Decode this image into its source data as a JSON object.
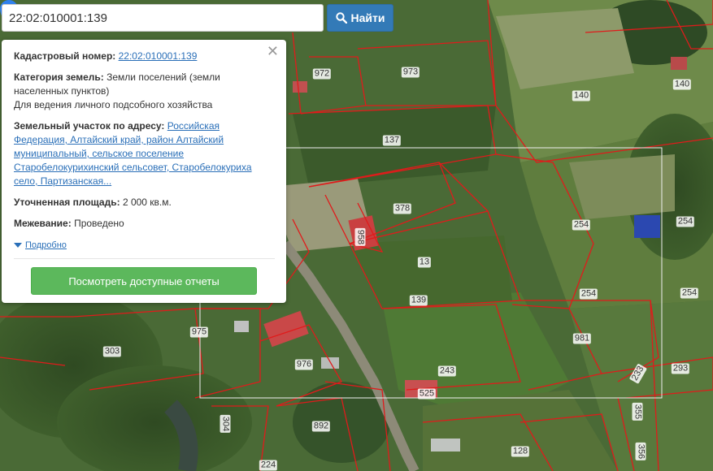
{
  "search": {
    "value": "22:02:010001:139",
    "button_label": "Найти"
  },
  "popup": {
    "cadastral_label": "Кадастровый номер:",
    "cadastral_value": "22:02:010001:139",
    "category_label": "Категория земель:",
    "category_value": "Земли поселений (земли населенных пунктов)",
    "category_note": "Для ведения личного подсобного хозяйства",
    "address_label": "Земельный участок по адресу:",
    "address_value": "Российская Федерация, Алтайский край, район Алтайский муниципальный, сельское поселение Старобелокурихинский сельсовет, Старобелокуриха село, Партизанская...",
    "area_label": "Уточненная площадь:",
    "area_value": "2 000 кв.м.",
    "survey_label": "Межевание:",
    "survey_value": "Проведено",
    "details_label": "Подробно",
    "reports_button": "Посмотреть доступные отчеты"
  },
  "map": {
    "parcels": [
      "972",
      "973",
      "140",
      "140",
      "137",
      "378",
      "958",
      "254",
      "254",
      "13",
      "139",
      "254",
      "254",
      "975",
      "303",
      "981",
      "976",
      "243",
      "293",
      "233",
      "525",
      "355",
      "892",
      "304",
      "128",
      "224",
      "356"
    ],
    "colors": {
      "boundary": "#e01b1b",
      "pin": "#2f80ed"
    }
  }
}
